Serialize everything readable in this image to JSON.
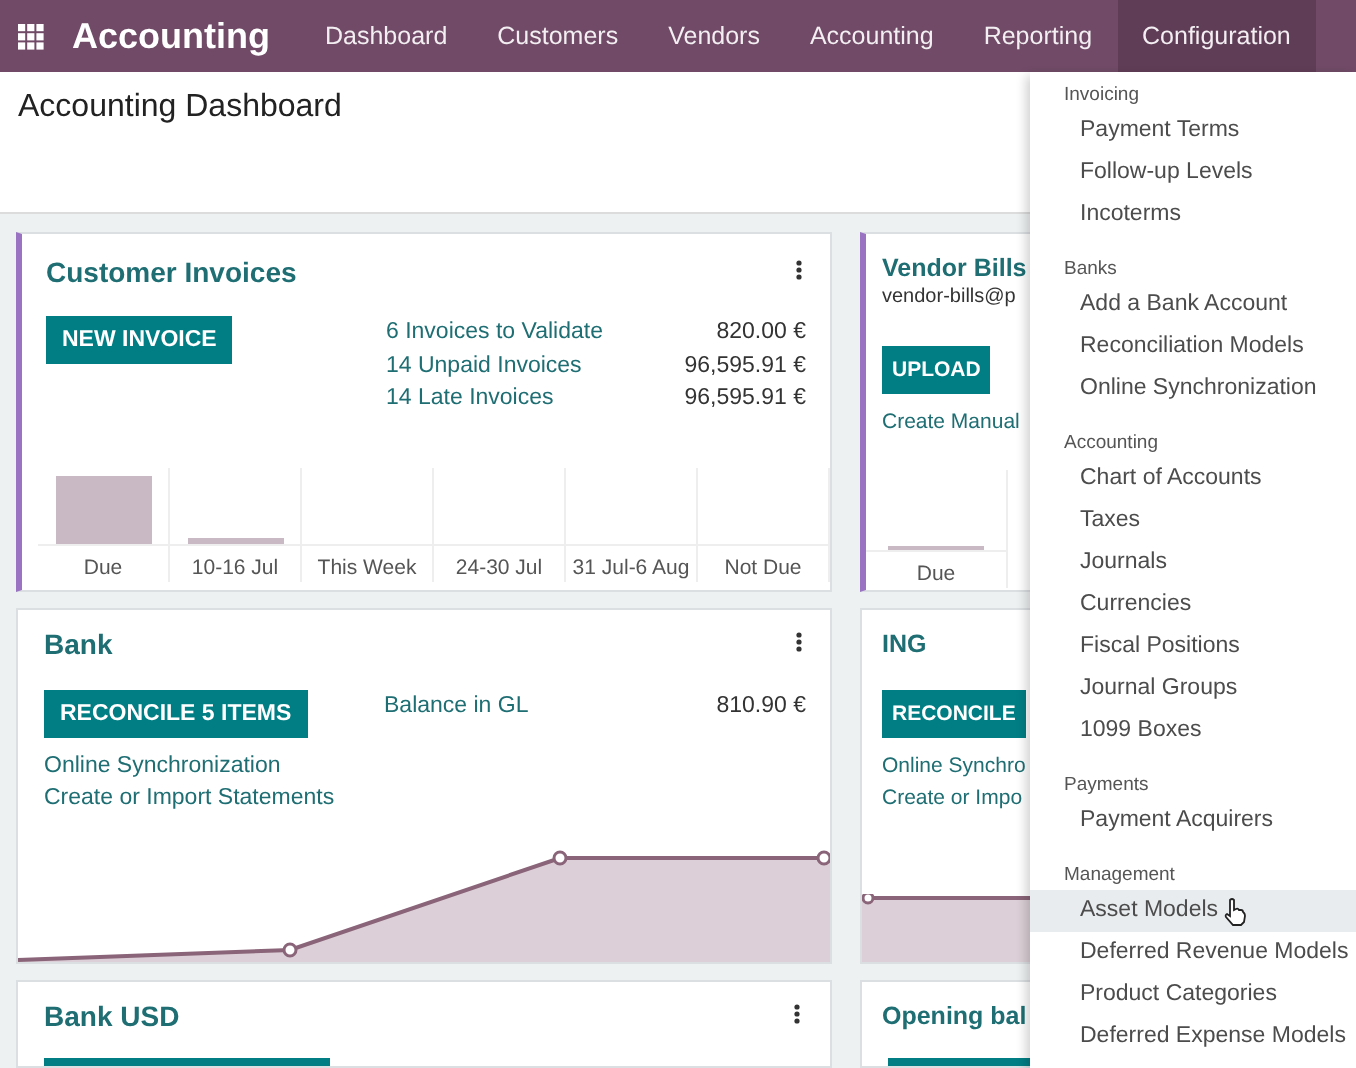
{
  "navbar": {
    "app_name": "Accounting",
    "items": [
      {
        "label": "Dashboard",
        "selected": false
      },
      {
        "label": "Customers",
        "selected": false
      },
      {
        "label": "Vendors",
        "selected": false
      },
      {
        "label": "Accounting",
        "selected": false
      },
      {
        "label": "Reporting",
        "selected": false
      },
      {
        "label": "Configuration",
        "selected": true
      }
    ]
  },
  "page_title": "Accounting Dashboard",
  "left_cards": [
    {
      "kind": "sales",
      "title": "Customer Invoices",
      "highlighted": true,
      "button": "NEW INVOICE",
      "stats": [
        {
          "label": "6 Invoices to Validate",
          "value": "820.00 €"
        },
        {
          "label": "14 Unpaid Invoices",
          "value": "96,595.91 €"
        },
        {
          "label": "14 Late Invoices",
          "value": "96,595.91 €"
        }
      ],
      "x_labels": [
        "Due",
        "10-16 Jul",
        "This Week",
        "24-30 Jul",
        "31 Jul-6 Aug",
        "Not Due"
      ]
    },
    {
      "kind": "bank",
      "title": "Bank",
      "highlighted": false,
      "button": "RECONCILE 5 ITEMS",
      "stats": [
        {
          "label": "Balance in GL",
          "value": "810.90 €"
        }
      ],
      "links": [
        "Online Synchronization",
        "Create or Import Statements"
      ]
    },
    {
      "kind": "stub",
      "title": "Bank USD",
      "highlighted": false
    }
  ],
  "right_cards": [
    {
      "kind": "purchase",
      "title": "Vendor Bills",
      "highlighted": true,
      "subtitle": "vendor-bills@p",
      "button": "UPLOAD",
      "links": [
        "Create Manual"
      ],
      "x_labels": [
        "Due"
      ]
    },
    {
      "kind": "bank",
      "title": "ING",
      "highlighted": false,
      "button": "RECONCILE",
      "links": [
        "Online Synchro",
        "Create or Impo"
      ]
    },
    {
      "kind": "stub",
      "title": "Opening bal",
      "highlighted": false
    }
  ],
  "dropdown": {
    "sections": [
      {
        "header": "Invoicing",
        "items": [
          {
            "label": "Payment Terms",
            "selected": false
          },
          {
            "label": "Follow-up Levels",
            "selected": false
          },
          {
            "label": "Incoterms",
            "selected": false
          }
        ]
      },
      {
        "header": "Banks",
        "items": [
          {
            "label": "Add a Bank Account",
            "selected": false
          },
          {
            "label": "Reconciliation Models",
            "selected": false
          },
          {
            "label": "Online Synchronization",
            "selected": false
          }
        ]
      },
      {
        "header": "Accounting",
        "items": [
          {
            "label": "Chart of Accounts",
            "selected": false
          },
          {
            "label": "Taxes",
            "selected": false
          },
          {
            "label": "Journals",
            "selected": false
          },
          {
            "label": "Currencies",
            "selected": false
          },
          {
            "label": "Fiscal Positions",
            "selected": false
          },
          {
            "label": "Journal Groups",
            "selected": false
          },
          {
            "label": "1099 Boxes",
            "selected": false
          }
        ]
      },
      {
        "header": "Payments",
        "items": [
          {
            "label": "Payment Acquirers",
            "selected": false
          }
        ]
      },
      {
        "header": "Management",
        "items": [
          {
            "label": "Asset Models",
            "selected": true
          },
          {
            "label": "Deferred Revenue Models",
            "selected": false
          },
          {
            "label": "Product Categories",
            "selected": false
          },
          {
            "label": "Deferred Expense Models",
            "selected": false
          }
        ]
      }
    ]
  }
}
